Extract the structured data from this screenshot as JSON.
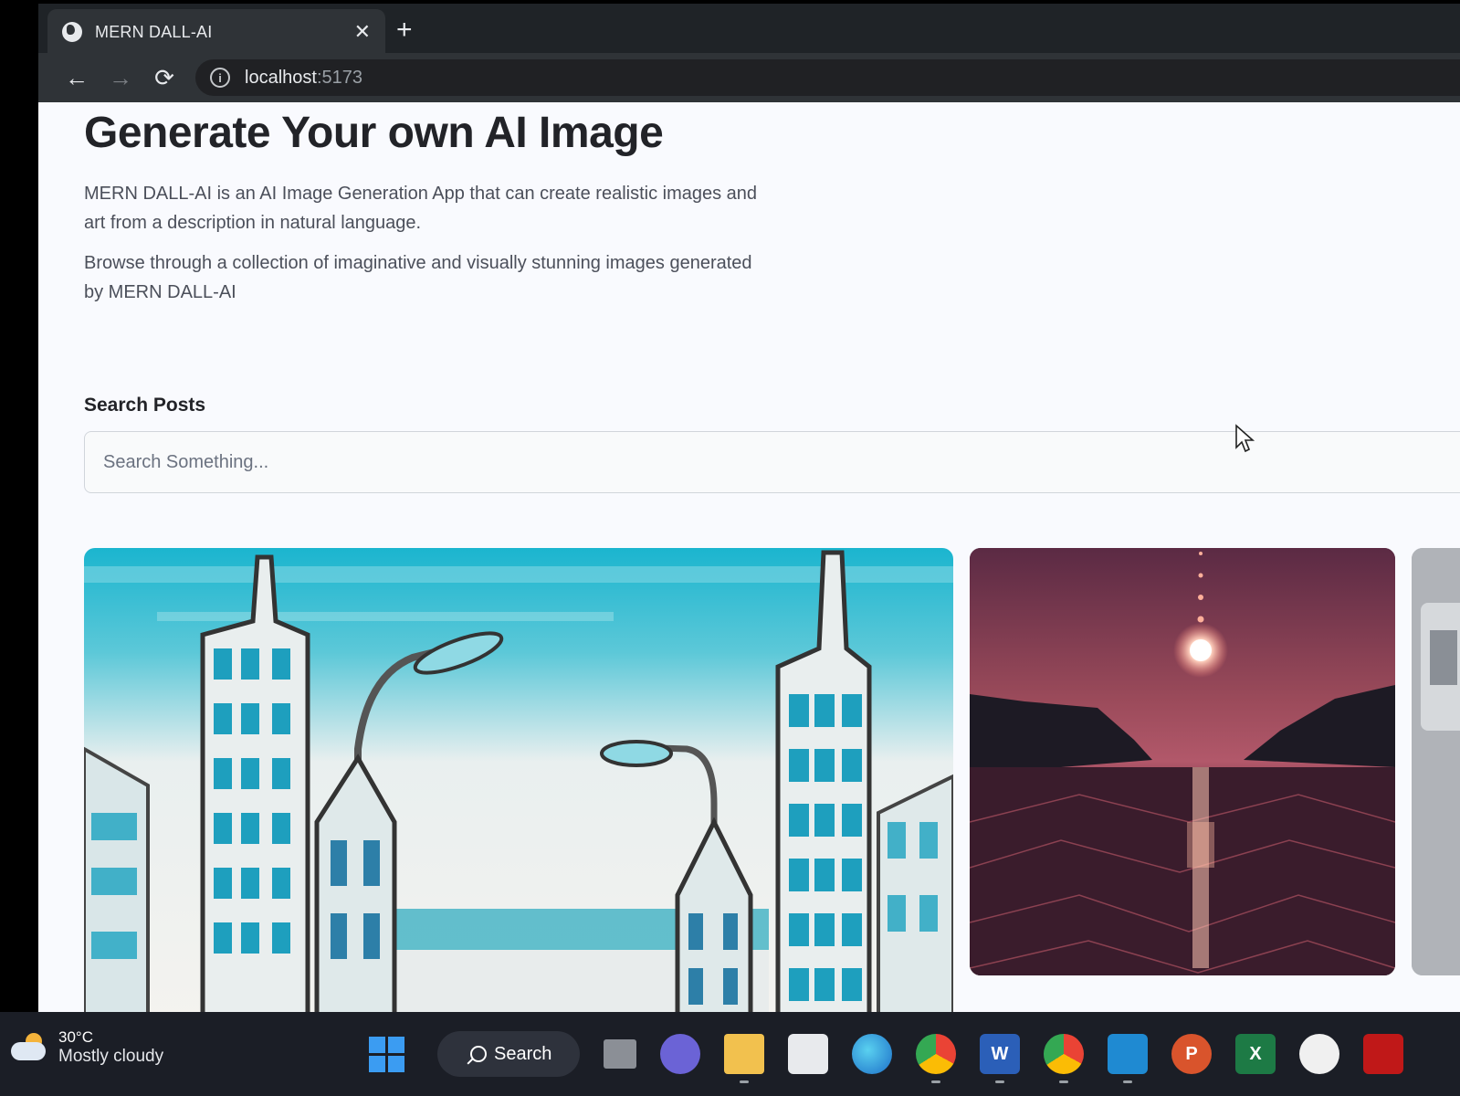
{
  "browser": {
    "tab_title": "MERN DALL-AI",
    "tab_close": "✕",
    "new_tab": "+",
    "nav": {
      "back": "←",
      "forward": "→",
      "reload": "⟳"
    },
    "url_host": "localhost",
    "url_port": ":5173"
  },
  "page": {
    "heading": "Generate Your own AI Image",
    "description_1": "MERN DALL-AI is an AI Image Generation App that can create realistic images and art from a description in natural language.",
    "description_2": "Browse through a collection of imaginative and visually stunning images generated by MERN DALL-AI",
    "search_label": "Search Posts",
    "search_placeholder": "Search Something..."
  },
  "taskbar": {
    "weather_temp": "30°C",
    "weather_text": "Mostly cloudy",
    "search_label": "Search",
    "apps": [
      "task-view",
      "teams",
      "file-explorer",
      "store",
      "edge",
      "chrome",
      "word",
      "chrome-profile",
      "vscode",
      "powerpoint",
      "excel",
      "github",
      "mcafee"
    ]
  }
}
